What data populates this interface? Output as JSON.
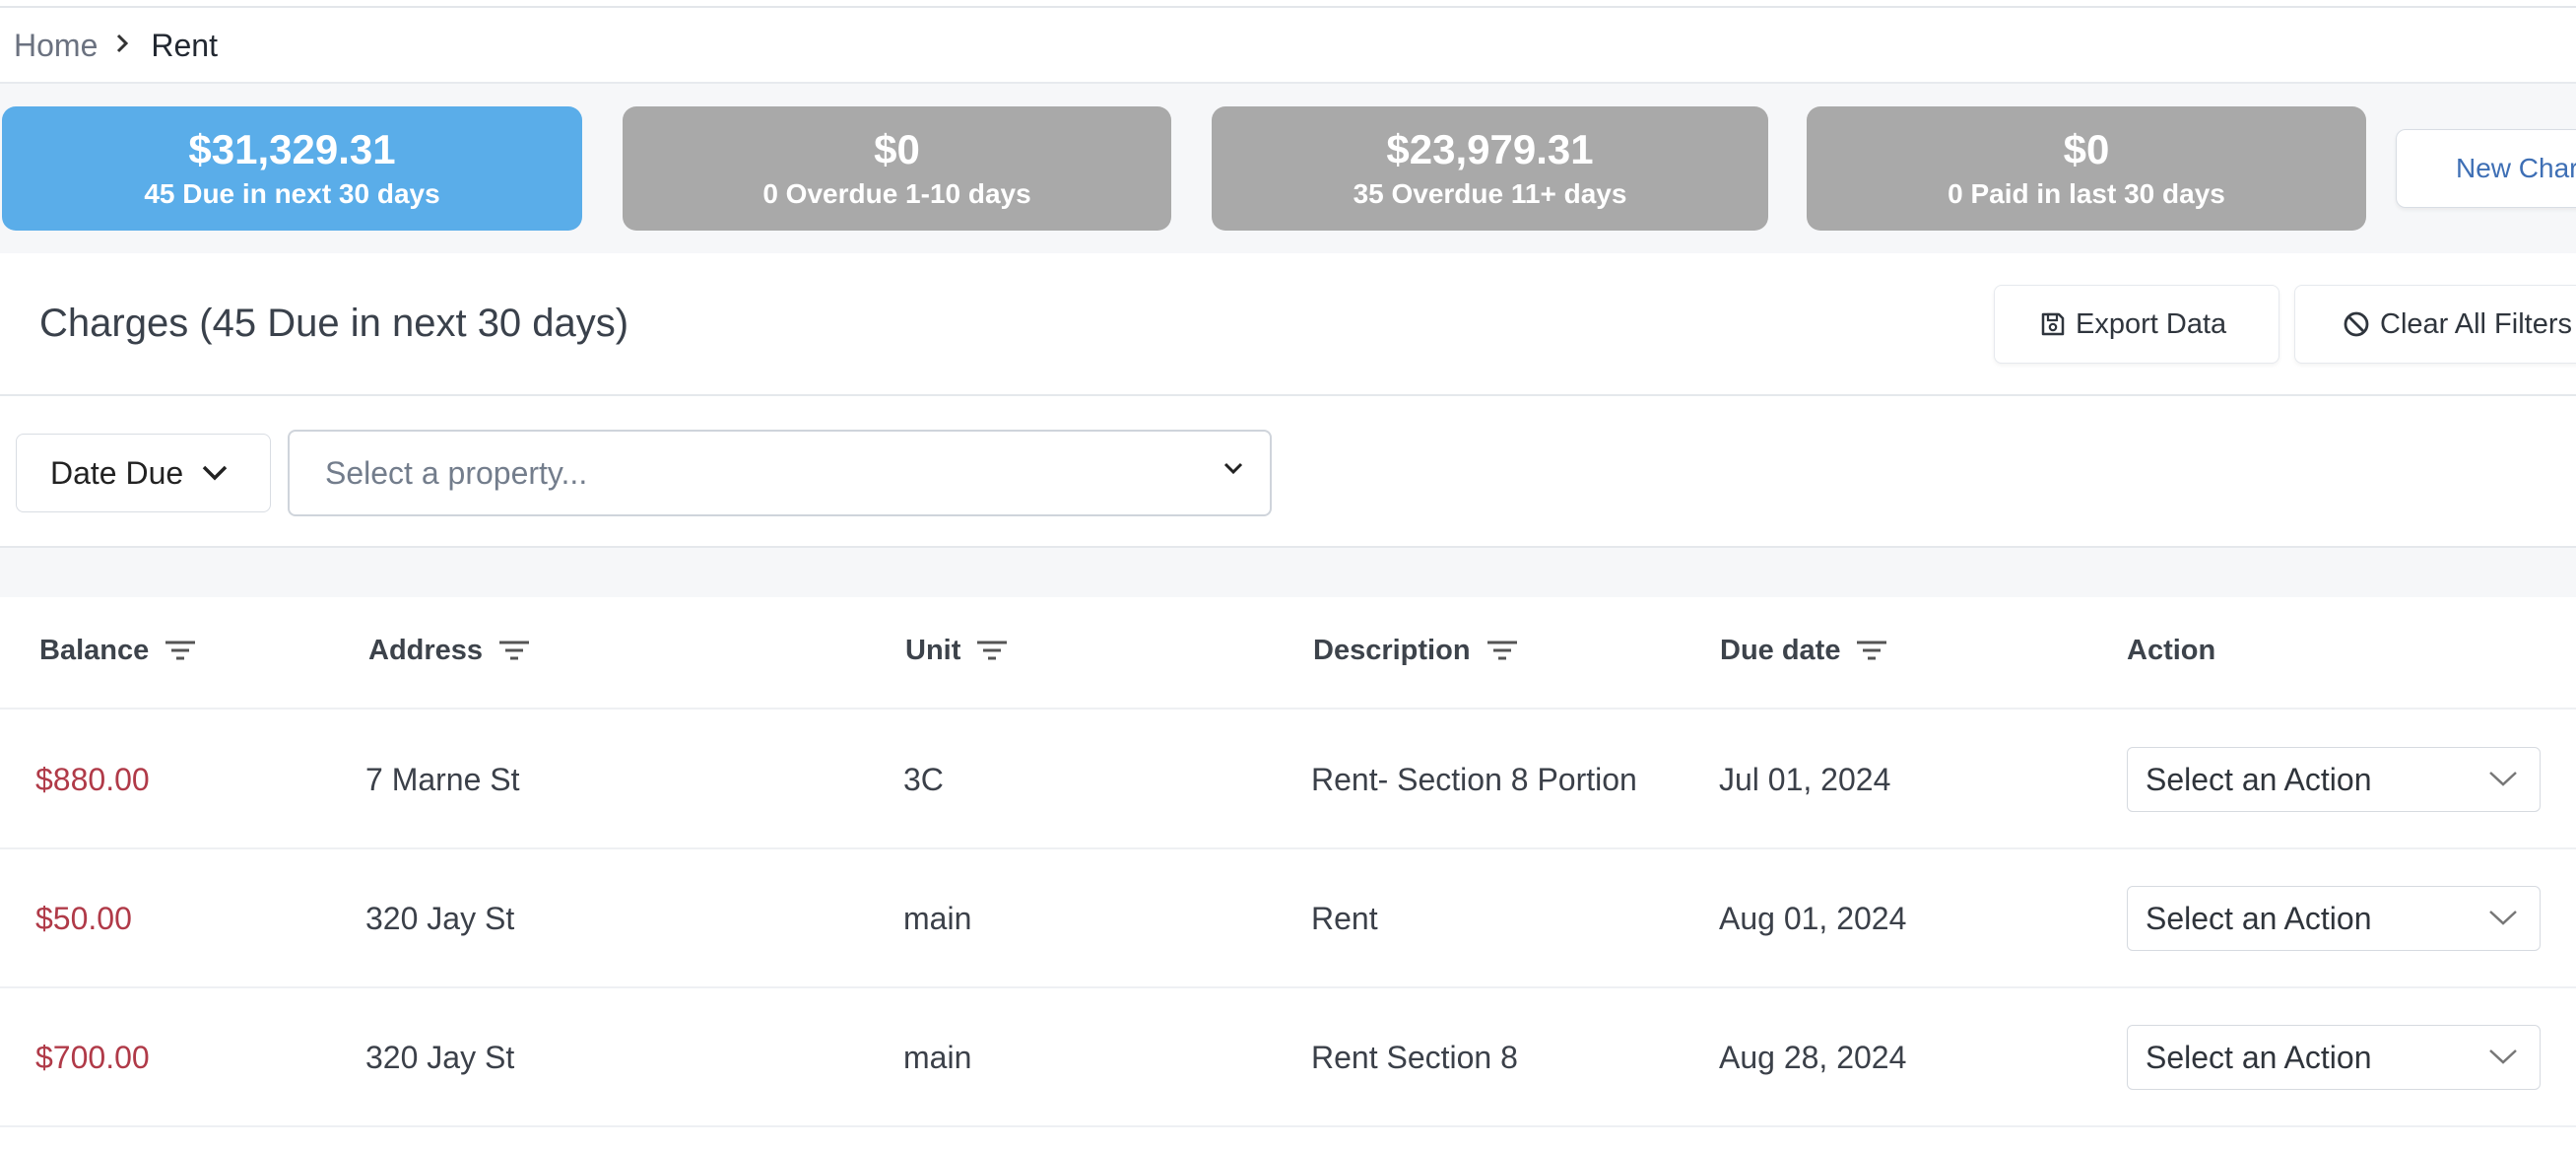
{
  "breadcrumb": {
    "home": "Home",
    "current": "Rent"
  },
  "summary_cards": [
    {
      "amount": "$31,329.31",
      "label": "45 Due in next 30 days",
      "active": true
    },
    {
      "amount": "$0",
      "label": "0 Overdue 1-10 days",
      "active": false
    },
    {
      "amount": "$23,979.31",
      "label": "35 Overdue 11+ days",
      "active": false
    },
    {
      "amount": "$0",
      "label": "0 Paid in last 30 days",
      "active": false
    }
  ],
  "new_charge_label": "New Charge",
  "section": {
    "title": "Charges (45 Due in next 30 days)"
  },
  "toolbar": {
    "export_label": "Export Data",
    "clear_label": "Clear All Filters"
  },
  "filters": {
    "date_due_label": "Date Due",
    "property_placeholder": "Select a property..."
  },
  "table": {
    "columns": [
      "Balance",
      "Address",
      "Unit",
      "Description",
      "Due date",
      "Action"
    ],
    "rows": [
      {
        "balance": "$880.00",
        "address": "7 Marne St",
        "unit": "3C",
        "description": "Rent- Section 8 Portion",
        "due_date": "Jul 01, 2024",
        "action": "Select an Action"
      },
      {
        "balance": "$50.00",
        "address": "320 Jay St",
        "unit": "main",
        "description": "Rent",
        "due_date": "Aug 01, 2024",
        "action": "Select an Action"
      },
      {
        "balance": "$700.00",
        "address": "320 Jay St",
        "unit": "main",
        "description": "Rent Section 8",
        "due_date": "Aug 28, 2024",
        "action": "Select an Action"
      }
    ]
  },
  "colors": {
    "active_card": "#5aade9",
    "idle_card": "#a9a9a9",
    "balance_text": "#b03a48",
    "link": "#3e6fb5"
  },
  "icons": {
    "breadcrumb_separator": "chevron-right-icon",
    "export": "floppy-disk-icon",
    "clear": "ban-icon",
    "column_filter": "filter-icon",
    "dropdown": "chevron-down-icon"
  }
}
